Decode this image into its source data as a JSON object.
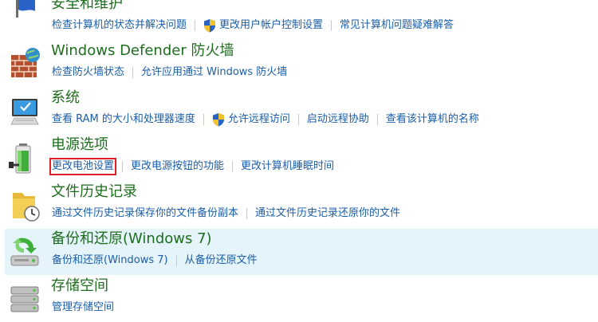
{
  "categories": [
    {
      "title": "安全和维护",
      "icon": "flag-icon",
      "links": [
        {
          "label": "检查计算机的状态并解决问题",
          "shield": false
        },
        {
          "label": "更改用户帐户控制设置",
          "shield": true
        },
        {
          "label": "常见计算机问题疑难解答",
          "shield": false
        }
      ]
    },
    {
      "title": "Windows Defender 防火墙",
      "icon": "firewall-icon",
      "links": [
        {
          "label": "检查防火墙状态",
          "shield": false
        },
        {
          "label": "允许应用通过 Windows 防火墙",
          "shield": false
        }
      ]
    },
    {
      "title": "系统",
      "icon": "computer-icon",
      "links": [
        {
          "label": "查看 RAM 的大小和处理器速度",
          "shield": false
        },
        {
          "label": "允许远程访问",
          "shield": true
        },
        {
          "label": "启动远程协助",
          "shield": false
        },
        {
          "label": "查看该计算机的名称",
          "shield": false
        }
      ]
    },
    {
      "title": "电源选项",
      "icon": "battery-icon",
      "links": [
        {
          "label": "更改电池设置",
          "shield": false,
          "highlighted": true
        },
        {
          "label": "更改电源按钮的功能",
          "shield": false
        },
        {
          "label": "更改计算机睡眠时间",
          "shield": false
        }
      ]
    },
    {
      "title": "文件历史记录",
      "icon": "file-history-icon",
      "links": [
        {
          "label": "通过文件历史记录保存你的文件备份副本",
          "shield": false
        },
        {
          "label": "通过文件历史记录还原你的文件",
          "shield": false
        }
      ]
    },
    {
      "title": "备份和还原(Windows 7)",
      "icon": "backup-icon",
      "hovered": true,
      "links": [
        {
          "label": "备份和还原(Windows 7)",
          "shield": false
        },
        {
          "label": "从备份还原文件",
          "shield": false
        }
      ]
    },
    {
      "title": "存储空间",
      "icon": "storage-icon",
      "links": [
        {
          "label": "管理存储空间",
          "shield": false
        }
      ]
    }
  ],
  "colors": {
    "title": "#1e6e1e",
    "link": "#1a5ea8",
    "hover": "#e5f3fb",
    "highlight_box": "#e0212b"
  }
}
